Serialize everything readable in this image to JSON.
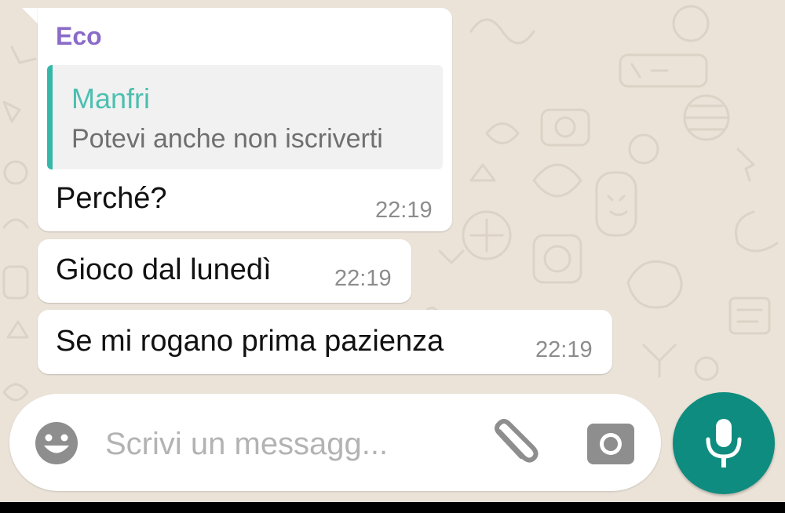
{
  "colors": {
    "background": "#ebe3d8",
    "bubble": "#ffffff",
    "sender_name": "#8a6bc7",
    "quote_bar": "#35b7a8",
    "quote_author": "#4cbfb0",
    "accent": "#0e8c7f"
  },
  "messages": [
    {
      "sender": "Eco",
      "quote": {
        "author": "Manfri",
        "text": "Potevi anche non iscriverti"
      },
      "text": "Perché?",
      "time": "22:19"
    },
    {
      "text": "Gioco dal lunedì",
      "time": "22:19"
    },
    {
      "text": "Se mi rogano prima pazienza",
      "time": "22:19"
    }
  ],
  "composer": {
    "placeholder": "Scrivi un messagg...",
    "emoji_icon": "smiley-icon",
    "attach_icon": "paperclip-icon",
    "camera_icon": "camera-icon",
    "send_icon": "microphone-icon"
  }
}
